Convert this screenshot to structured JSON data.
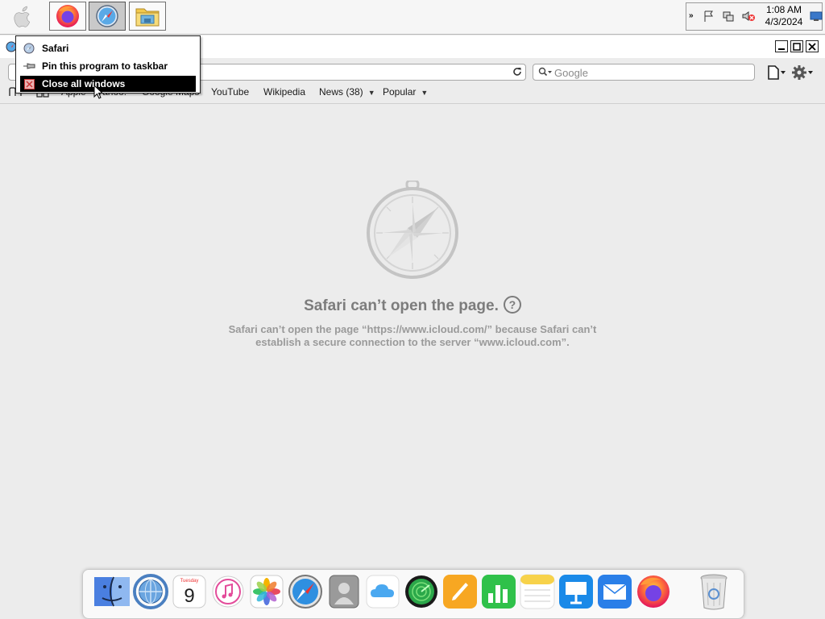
{
  "taskbar": {
    "apps": [
      {
        "name": "Firefox",
        "icon": "firefox-icon"
      },
      {
        "name": "Safari",
        "icon": "safari-icon",
        "active": true
      },
      {
        "name": "File Explorer",
        "icon": "folder-icon"
      }
    ],
    "clock": {
      "time": "1:08 AM",
      "date": "4/3/2024"
    }
  },
  "jumplist": {
    "items": [
      {
        "label": "Safari",
        "icon": "safari-icon"
      },
      {
        "label": "Pin this program to taskbar",
        "icon": "pin-icon"
      },
      {
        "label": "Close all windows",
        "icon": "close-window-icon",
        "highlighted": true
      }
    ]
  },
  "toolbar": {
    "search_placeholder": "Google"
  },
  "bookmarks": [
    {
      "label": "Apple"
    },
    {
      "label": "Yahoo!"
    },
    {
      "label": "Google Maps"
    },
    {
      "label": "YouTube"
    },
    {
      "label": "Wikipedia"
    },
    {
      "label": "News (38)",
      "dropdown": true
    },
    {
      "label": "Popular",
      "dropdown": true
    }
  ],
  "error": {
    "title": "Safari can’t open the page.",
    "help": "?",
    "message": "Safari can’t open the page “https://www.icloud.com/” because Safari can’t establish a secure connection to the server “www.icloud.com”."
  },
  "dock": {
    "items": [
      "finder-icon",
      "network-icon",
      "calendar-icon",
      "music-icon",
      "photos-icon",
      "safari-icon",
      "contacts-icon",
      "icloud-icon",
      "find-my-icon",
      "pages-icon",
      "numbers-icon",
      "notes-icon",
      "keynote-icon",
      "mail-icon",
      "firefox-icon",
      "trash-icon"
    ],
    "calendar_day": "9",
    "calendar_weekday": "Tuesday"
  },
  "colors": {
    "accent": "#000000",
    "error_text": "#7c7c7c",
    "dock_bg": "#fafafa"
  }
}
